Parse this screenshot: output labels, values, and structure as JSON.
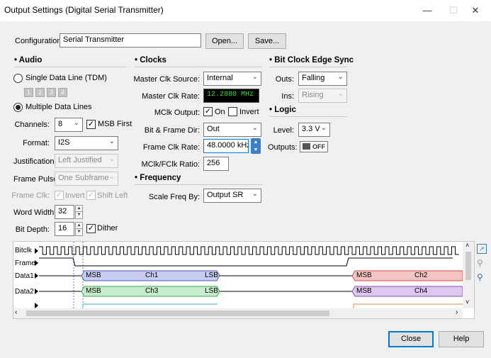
{
  "window": {
    "title": "Output Settings (Digital Serial Transmitter)",
    "minimize": "—",
    "maximize": "☐",
    "close": "✕"
  },
  "configuration": {
    "label": "Configuration:",
    "value": "Serial Transmitter",
    "open_label": "Open...",
    "save_label": "Save..."
  },
  "audio": {
    "title": "Audio",
    "single_line": "Single Data Line (TDM)",
    "tdm_boxes": [
      "1",
      "2",
      "3",
      "4"
    ],
    "multiple_lines": "Multiple Data Lines",
    "channels_label": "Channels:",
    "channels_value": "8",
    "msb_first_label": "MSB First",
    "format_label": "Format:",
    "format_value": "I2S",
    "justification_label": "Justification:",
    "justification_value": "Left Justified",
    "frame_pulse_label": "Frame Pulse:",
    "frame_pulse_value": "One Subframe",
    "frame_clk_label": "Frame Clk:",
    "invert_label": "Invert",
    "shift_left_label": "Shift Left",
    "word_width_label": "Word Width:",
    "word_width_value": "32",
    "bit_depth_label": "Bit Depth:",
    "bit_depth_value": "16",
    "dither_label": "Dither"
  },
  "clocks": {
    "title": "Clocks",
    "master_source_label": "Master Clk Source:",
    "master_source_value": "Internal",
    "master_rate_label": "Master Clk Rate:",
    "master_rate_value": "12.2880 MHz",
    "mclk_output_label": "MClk Output:",
    "on_label": "On",
    "invert_label": "Invert",
    "bit_frame_dir_label": "Bit & Frame Dir:",
    "bit_frame_dir_value": "Out",
    "frame_clk_rate_label": "Frame Clk Rate:",
    "frame_clk_rate_value": "48.0000 kHz",
    "ratio_label": "MClk/FClk Ratio:",
    "ratio_value": "256"
  },
  "frequency": {
    "title": "Frequency",
    "scale_label": "Scale Freq By:",
    "scale_value": "Output SR"
  },
  "edge_sync": {
    "title": "Bit Clock Edge Sync",
    "outs_label": "Outs:",
    "outs_value": "Falling",
    "ins_label": "Ins:",
    "ins_value": "Rising"
  },
  "logic": {
    "title": "Logic",
    "level_label": "Level:",
    "level_value": "3.3 V",
    "outputs_label": "Outputs:",
    "outputs_value": "OFF"
  },
  "timing": {
    "signals": [
      "Bitclk",
      "Frame",
      "Data1",
      "Data2"
    ],
    "data1_pills": [
      {
        "msb": "MSB",
        "ch": "Ch1",
        "lsb": "LSB"
      },
      {
        "msb": "MSB",
        "ch": "Ch2"
      }
    ],
    "data2_pills": [
      {
        "msb": "MSB",
        "ch": "Ch3",
        "lsb": "LSB"
      },
      {
        "msb": "MSB",
        "ch": "Ch4"
      }
    ],
    "colors": {
      "ch1": "#c7cdf0",
      "ch2": "#f5c5c5",
      "ch3": "#c6eccb",
      "ch4": "#dcc7ee",
      "ch1_border": "#4b5bbf",
      "ch2_border": "#d04a4a",
      "ch3_border": "#38a84e",
      "ch4_border": "#8d4bc4"
    }
  },
  "footer": {
    "close_label": "Close",
    "help_label": "Help"
  }
}
